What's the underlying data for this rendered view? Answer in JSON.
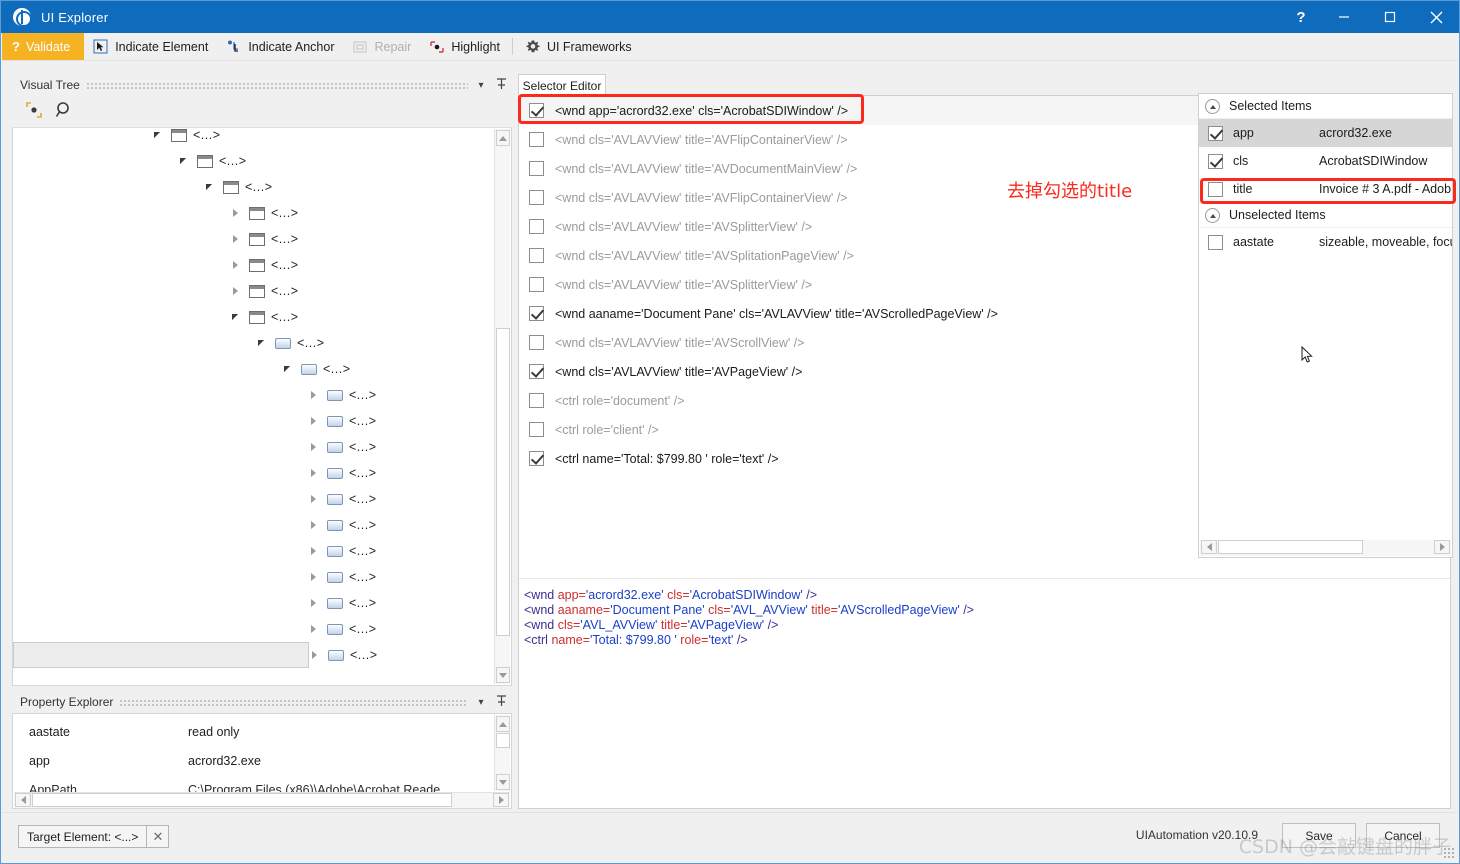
{
  "window": {
    "title": "UI Explorer",
    "logo_icon": "globe-icon",
    "help_label": "?",
    "minimize_label": "─",
    "maximize_label": "☐",
    "close_label": "✕"
  },
  "toolbar": {
    "validate": {
      "label": "Validate",
      "icon": "question-mark-icon"
    },
    "items": [
      {
        "label": "Indicate Element",
        "icon": "cursor-arrow-icon",
        "disabled": false
      },
      {
        "label": "Indicate Anchor",
        "icon": "anchor-point-icon",
        "disabled": false
      },
      {
        "label": "Repair",
        "icon": "repair-box-icon",
        "disabled": true
      },
      {
        "label": "Highlight",
        "icon": "highlight-icon",
        "disabled": false
      },
      {
        "label": "UI Frameworks",
        "icon": "gear-icon",
        "disabled": false
      }
    ]
  },
  "visual_tree": {
    "title": "Visual Tree",
    "collapse_label": "▾",
    "pin_label": "📌",
    "refresh_icon": "refresh-indicate-icon",
    "search_icon": "search-icon",
    "node_label": "<...>",
    "nodes": [
      {
        "indent": 0,
        "state": "expanded",
        "icon": "window-icon",
        "selected": false
      },
      {
        "indent": 1,
        "state": "expanded",
        "icon": "window-icon",
        "selected": false
      },
      {
        "indent": 2,
        "state": "expanded",
        "icon": "window-icon",
        "selected": false
      },
      {
        "indent": 3,
        "state": "collapsed",
        "icon": "window-icon",
        "selected": false
      },
      {
        "indent": 3,
        "state": "collapsed",
        "icon": "window-icon",
        "selected": false
      },
      {
        "indent": 3,
        "state": "collapsed",
        "icon": "window-icon",
        "selected": false
      },
      {
        "indent": 3,
        "state": "collapsed",
        "icon": "window-icon",
        "selected": false
      },
      {
        "indent": 3,
        "state": "expanded",
        "icon": "window-icon",
        "selected": false
      },
      {
        "indent": 4,
        "state": "expanded",
        "icon": "control-icon",
        "selected": false
      },
      {
        "indent": 5,
        "state": "expanded",
        "icon": "control-icon",
        "selected": false
      },
      {
        "indent": 6,
        "state": "collapsed",
        "icon": "control-icon",
        "selected": false
      },
      {
        "indent": 6,
        "state": "collapsed",
        "icon": "control-icon",
        "selected": false
      },
      {
        "indent": 6,
        "state": "collapsed",
        "icon": "control-icon",
        "selected": false
      },
      {
        "indent": 6,
        "state": "collapsed",
        "icon": "control-icon",
        "selected": false
      },
      {
        "indent": 6,
        "state": "collapsed",
        "icon": "control-icon",
        "selected": false
      },
      {
        "indent": 6,
        "state": "collapsed",
        "icon": "control-icon",
        "selected": false
      },
      {
        "indent": 6,
        "state": "collapsed",
        "icon": "control-icon",
        "selected": false
      },
      {
        "indent": 6,
        "state": "collapsed",
        "icon": "control-icon",
        "selected": false
      },
      {
        "indent": 6,
        "state": "collapsed",
        "icon": "control-icon",
        "selected": false
      },
      {
        "indent": 6,
        "state": "collapsed",
        "icon": "control-icon",
        "selected": false
      },
      {
        "indent": 6,
        "state": "collapsed",
        "icon": "control-icon",
        "selected": true
      }
    ]
  },
  "property_explorer": {
    "title": "Property Explorer",
    "collapse_label": "▾",
    "pin_label": "📌",
    "rows": [
      {
        "key": "aastate",
        "value": "read only"
      },
      {
        "key": "app",
        "value": "acrord32.exe"
      },
      {
        "key": "AppPath",
        "value": "C:\\Program Files (x86)\\Adobe\\Acrobat Reade"
      }
    ]
  },
  "selector_editor": {
    "tab_label": "Selector Editor",
    "rows": [
      {
        "checked": true,
        "text": "<wnd app='acrord32.exe' cls='AcrobatSDIWindow' />",
        "enabled": true,
        "highlighted": true
      },
      {
        "checked": false,
        "text": "<wnd cls='AVLAVView' title='AVFlipContainerView' />",
        "enabled": false,
        "highlighted": false
      },
      {
        "checked": false,
        "text": "<wnd cls='AVLAVView' title='AVDocumentMainView' />",
        "enabled": false,
        "highlighted": false
      },
      {
        "checked": false,
        "text": "<wnd cls='AVLAVView' title='AVFlipContainerView' />",
        "enabled": false,
        "highlighted": false
      },
      {
        "checked": false,
        "text": "<wnd cls='AVLAVView' title='AVSplitterView' />",
        "enabled": false,
        "highlighted": false
      },
      {
        "checked": false,
        "text": "<wnd cls='AVLAVView' title='AVSplitationPageView' />",
        "enabled": false,
        "highlighted": false
      },
      {
        "checked": false,
        "text": "<wnd cls='AVLAVView' title='AVSplitterView' />",
        "enabled": false,
        "highlighted": false
      },
      {
        "checked": true,
        "text": "<wnd aaname='Document Pane' cls='AVLAVView' title='AVScrolledPageView' />",
        "enabled": true,
        "highlighted": false
      },
      {
        "checked": false,
        "text": "<wnd cls='AVLAVView' title='AVScrollView' />",
        "enabled": false,
        "highlighted": false
      },
      {
        "checked": true,
        "text": "<wnd cls='AVLAVView' title='AVPageView' />",
        "enabled": true,
        "highlighted": false
      },
      {
        "checked": false,
        "text": "<ctrl role='document' />",
        "enabled": false,
        "highlighted": false
      },
      {
        "checked": false,
        "text": "<ctrl role='client' />",
        "enabled": false,
        "highlighted": false
      },
      {
        "checked": true,
        "text": "<ctrl name='Total:   $799.80  ' role='text' />",
        "enabled": true,
        "highlighted": false
      }
    ],
    "preview": [
      [
        {
          "t": "<wnd ",
          "c": "tag"
        },
        {
          "t": "app=",
          "c": "attr"
        },
        {
          "t": "'acrord32.exe'",
          "c": "val"
        },
        {
          "t": " ",
          "c": "tag"
        },
        {
          "t": "cls=",
          "c": "attr"
        },
        {
          "t": "'AcrobatSDIWindow'",
          "c": "val"
        },
        {
          "t": " />",
          "c": "tag"
        }
      ],
      [
        {
          "t": "<wnd ",
          "c": "tag"
        },
        {
          "t": "aaname=",
          "c": "attr"
        },
        {
          "t": "'Document Pane'",
          "c": "val"
        },
        {
          "t": " ",
          "c": "tag"
        },
        {
          "t": "cls=",
          "c": "attr"
        },
        {
          "t": "'AVL_AVView'",
          "c": "val"
        },
        {
          "t": " ",
          "c": "tag"
        },
        {
          "t": "title=",
          "c": "attr"
        },
        {
          "t": "'AVScrolledPageView'",
          "c": "val"
        },
        {
          "t": " />",
          "c": "tag"
        }
      ],
      [
        {
          "t": "<wnd ",
          "c": "tag"
        },
        {
          "t": "cls=",
          "c": "attr"
        },
        {
          "t": "'AVL_AVView'",
          "c": "val"
        },
        {
          "t": " ",
          "c": "tag"
        },
        {
          "t": "title=",
          "c": "attr"
        },
        {
          "t": "'AVPageView'",
          "c": "val"
        },
        {
          "t": " />",
          "c": "tag"
        }
      ],
      [
        {
          "t": "<ctrl ",
          "c": "tag"
        },
        {
          "t": "name=",
          "c": "attr"
        },
        {
          "t": "'Total:   $799.80  '",
          "c": "val"
        },
        {
          "t": " ",
          "c": "tag"
        },
        {
          "t": "role=",
          "c": "attr"
        },
        {
          "t": "'text'",
          "c": "val"
        },
        {
          "t": " />",
          "c": "tag"
        }
      ]
    ]
  },
  "attributes_panel": {
    "groups": [
      {
        "title": "Selected Items",
        "items": [
          {
            "checked": true,
            "key": "app",
            "value": "acrord32.exe",
            "selected": true
          },
          {
            "checked": true,
            "key": "cls",
            "value": "AcrobatSDIWindow",
            "selected": false
          },
          {
            "checked": false,
            "key": "title",
            "value": "Invoice # 3 A.pdf - Adob",
            "selected": false
          }
        ]
      },
      {
        "title": "Unselected Items",
        "items": [
          {
            "checked": false,
            "key": "aastate",
            "value": "sizeable, moveable, focu",
            "selected": false
          }
        ]
      }
    ]
  },
  "annotation": {
    "text": "去掉勾选的title",
    "color": "#fb2a1d"
  },
  "bottom_bar": {
    "target_element_label": "Target Element: <...>",
    "target_close_label": "✕",
    "version": "UIAutomation v20.10.9",
    "save_label": "Save",
    "cancel_label": "Cancel",
    "watermark": "CSDN @会敲键盘的胖子"
  }
}
